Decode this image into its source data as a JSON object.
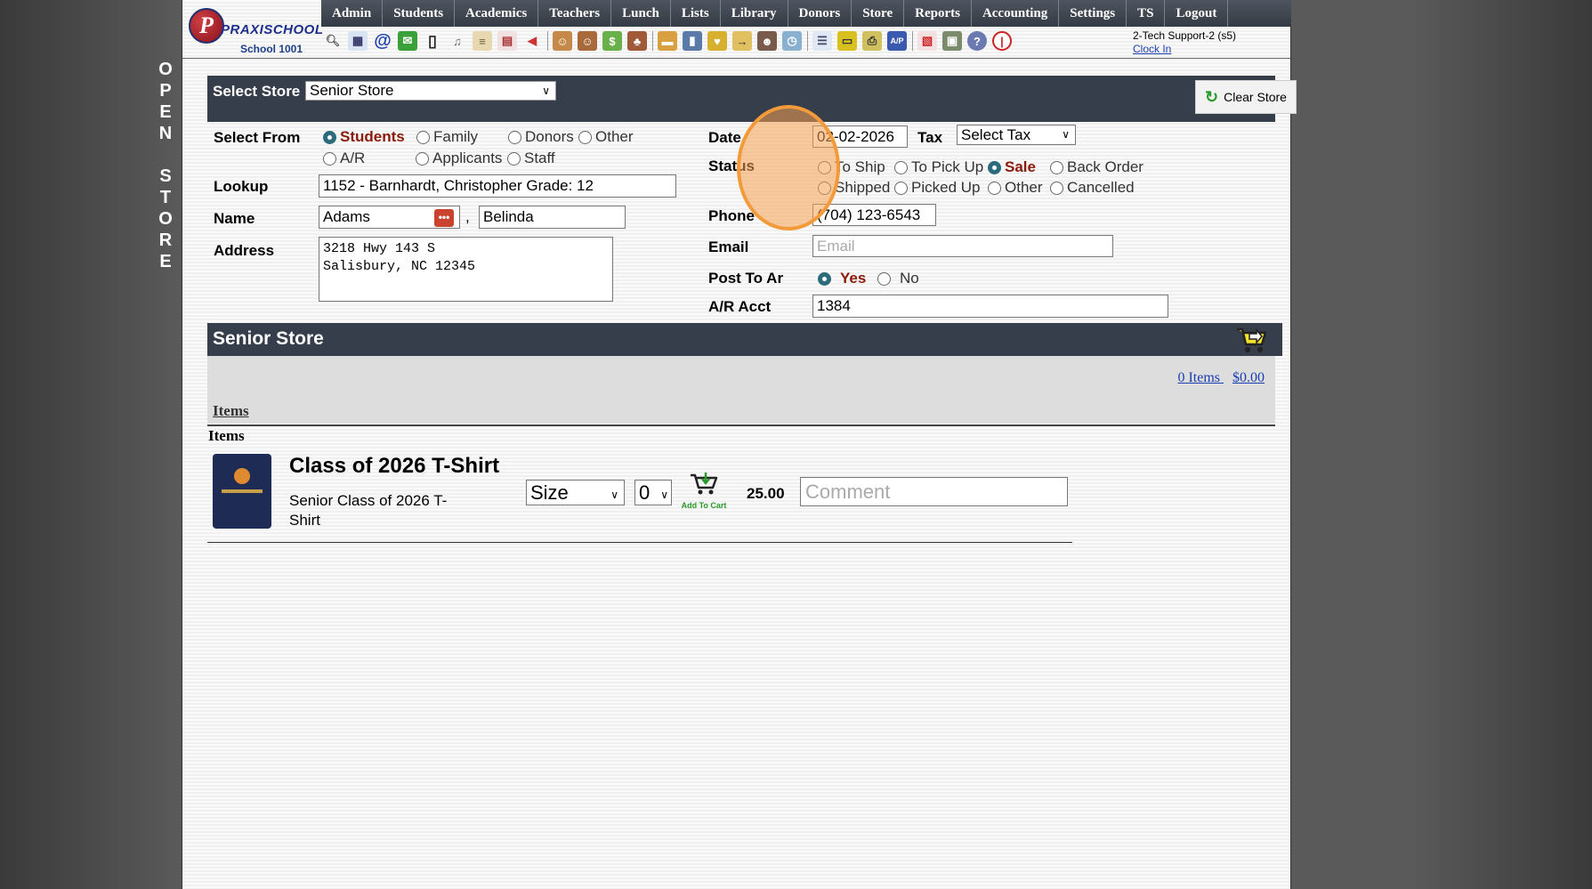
{
  "side_banner": [
    "O",
    "P",
    "E",
    "N",
    "",
    "S",
    "T",
    "O",
    "R",
    "E"
  ],
  "header": {
    "logo_initial": "P",
    "brand": "PRAXISCHOOL",
    "school": "School 1001",
    "menu": [
      "Admin",
      "Students",
      "Academics",
      "Teachers",
      "Lunch",
      "Lists",
      "Library",
      "Donors",
      "Store",
      "Reports",
      "Accounting",
      "Settings",
      "TS",
      "Logout"
    ],
    "user": "2-Tech Support-2 (s5)",
    "clock_in": "Clock In"
  },
  "store_bar": {
    "label": "Select Store",
    "selected_store": "Senior Store",
    "clear_label": "Clear Store"
  },
  "form": {
    "select_from_label": "Select From",
    "select_from_options": [
      "Students",
      "Family",
      "Donors",
      "Other",
      "A/R",
      "Applicants",
      "Staff"
    ],
    "select_from_selected": "Students",
    "lookup_label": "Lookup",
    "lookup_value": "1152 - Barnhardt, Christopher Grade: 12",
    "name_label": "Name",
    "last_name": "Adams",
    "name_sep": ",",
    "first_name": "Belinda",
    "address_label": "Address",
    "address_line1": "3218 Hwy 143 S",
    "address_line2": "Salisbury, NC 12345",
    "date_label": "Date",
    "date_value": "02-02-2026",
    "tax_label": "Tax",
    "tax_value": "Select Tax",
    "status_label": "Status",
    "status_options": [
      "To Ship",
      "To Pick Up",
      "Sale",
      "Back Order",
      "Shipped",
      "Picked Up",
      "Other",
      "Cancelled"
    ],
    "status_selected": "Sale",
    "phone_label": "Phone",
    "phone_value": "(704) 123-6543",
    "email_label": "Email",
    "email_placeholder": "Email",
    "post_to_ar_label": "Post To Ar",
    "post_yes": "Yes",
    "post_no": "No",
    "post_selected": "Yes",
    "ar_acct_label": "A/R Acct",
    "ar_acct_value": "1384"
  },
  "store_section": {
    "title": "Senior Store",
    "items_count": "0 Items",
    "total": "$0.00",
    "items_link": "Items",
    "items_heading": "Items"
  },
  "product": {
    "title": "Class of 2026 T-Shirt",
    "description": "Senior Class of 2026 T-Shirt",
    "size_value": "Size",
    "qty_value": "0",
    "add_to_cart": "Add To Cart",
    "price": "25.00",
    "comment_placeholder": "Comment"
  },
  "colors": {
    "header_bar": "#363d4b",
    "selected_red": "#8a1a0a",
    "link_blue": "#1a3fb0",
    "click_highlight": "#f39a3a"
  }
}
